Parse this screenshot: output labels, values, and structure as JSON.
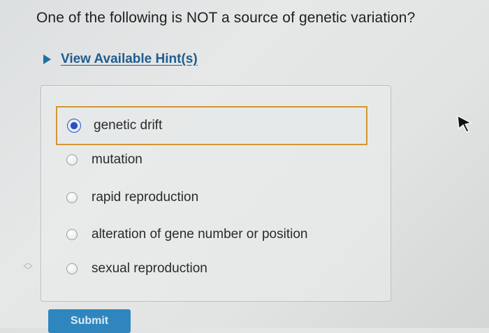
{
  "question": {
    "text": "One of the following is NOT a source of genetic variation?"
  },
  "hint": {
    "label": "View Available Hint(s)",
    "icon": "caret-right-icon"
  },
  "choices": [
    {
      "label": "genetic drift",
      "selected": true
    },
    {
      "label": "mutation",
      "selected": false
    },
    {
      "label": "rapid reproduction",
      "selected": false
    },
    {
      "label": "alteration of gene number or position",
      "selected": false
    },
    {
      "label": "sexual reproduction",
      "selected": false
    }
  ],
  "submit": {
    "label": "Submit"
  },
  "colors": {
    "link": "#1f5d8f",
    "radio_selected": "#2a4fc0",
    "selection_border": "#d19634",
    "submit_bg": "#2f86bf"
  }
}
